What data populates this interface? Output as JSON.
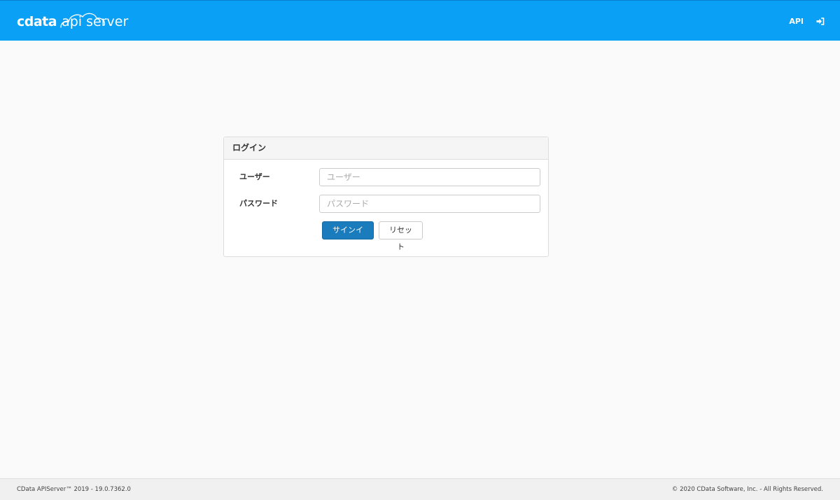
{
  "header": {
    "brand_primary": "cdata",
    "brand_secondary": "api server",
    "nav_api_label": "API",
    "signin_icon": "sign-in-icon",
    "background_color": "#0aa0f5"
  },
  "login_panel": {
    "title": "ログイン",
    "username": {
      "label": "ユーザー",
      "placeholder": "ユーザー",
      "value": ""
    },
    "password": {
      "label": "パスワード",
      "placeholder": "パスワード",
      "value": ""
    },
    "submit_label": "サインイン",
    "reset_label": "リセット",
    "submit_color": "#1a7bbd"
  },
  "footer": {
    "version_text": "CData APIServer™ 2019 - 19.0.7362.0",
    "copyright_text": "© 2020 CData Software, Inc. - All Rights Reserved."
  }
}
